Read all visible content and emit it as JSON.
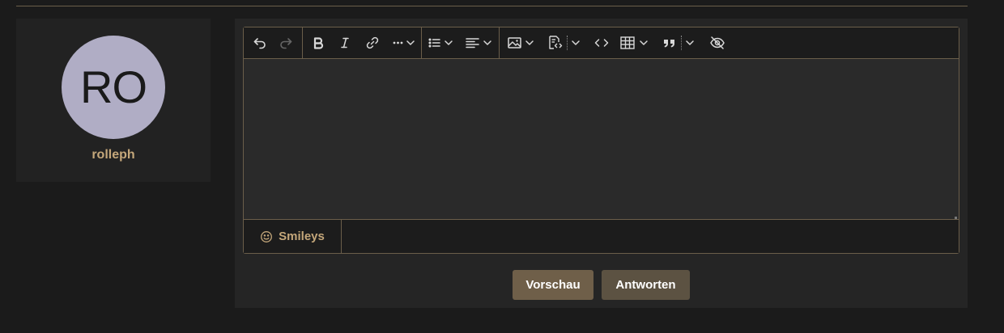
{
  "user": {
    "initials": "RO",
    "username": "rolleph",
    "avatar_color": "#b0adc5"
  },
  "toolbar": {
    "undo": "undo-icon",
    "redo": "redo-icon",
    "bold": "bold-icon",
    "italic": "italic-icon",
    "link": "link-icon",
    "more_text": "more-icon",
    "list": "list-icon",
    "align": "align-icon",
    "image": "image-icon",
    "code_block": "code-block-icon",
    "inline_code": "inline-code-icon",
    "table": "table-icon",
    "quote": "quote-icon",
    "spoiler": "eye-off-icon"
  },
  "editor": {
    "content": "",
    "smileys_label": "Smileys"
  },
  "actions": {
    "preview_label": "Vorschau",
    "reply_label": "Antworten"
  },
  "colors": {
    "accent": "#c4a77a",
    "border": "#6b5e4a",
    "preview_button": "#6f5f49",
    "reply_button": "#5c5242"
  }
}
